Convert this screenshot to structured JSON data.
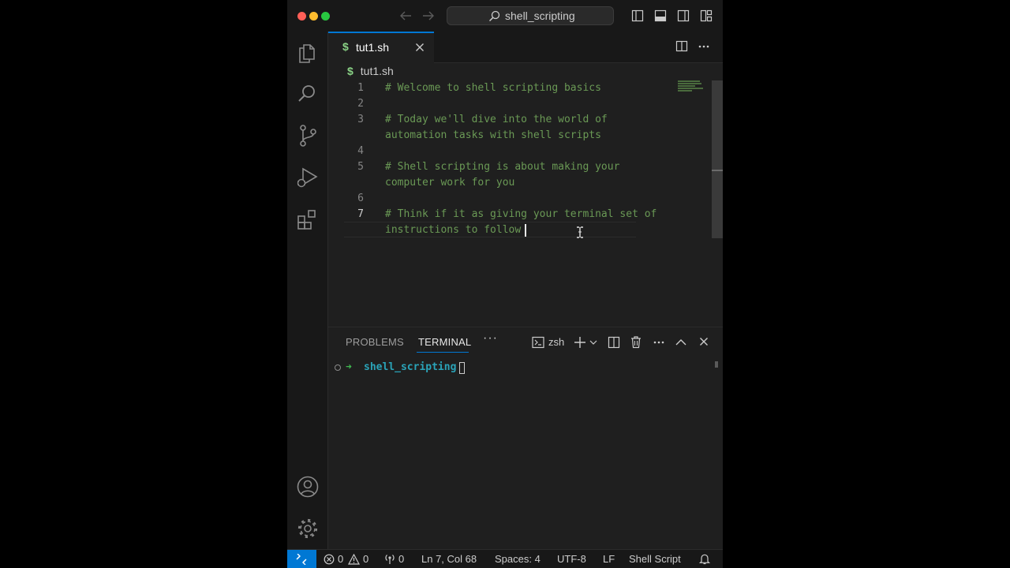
{
  "titlebar": {
    "search_label": "shell_scripting"
  },
  "editor": {
    "tab": {
      "icon": "$",
      "name": "tut1.sh"
    },
    "breadcrumb": {
      "icon": "$",
      "file": "tut1.sh"
    },
    "lines": [
      {
        "num": "1",
        "text": [
          "# Welcome to shell scripting basics"
        ]
      },
      {
        "num": "2",
        "text": [
          ""
        ]
      },
      {
        "num": "3",
        "text": [
          "# Today we'll dive into the world of",
          "automation tasks with shell scripts"
        ]
      },
      {
        "num": "4",
        "text": [
          ""
        ]
      },
      {
        "num": "5",
        "text": [
          "# Shell scripting is about making your",
          "computer work for you"
        ]
      },
      {
        "num": "6",
        "text": [
          ""
        ]
      },
      {
        "num": "7",
        "text": [
          "# Think if it as giving your terminal set of",
          "instructions to follow"
        ]
      }
    ]
  },
  "panel": {
    "tabs": {
      "problems": "PROBLEMS",
      "terminal": "TERMINAL"
    },
    "more": "···",
    "shell": "zsh",
    "terminal": {
      "prompt_arrow": "➜",
      "dir": "shell_scripting"
    }
  },
  "statusbar": {
    "errors": "0",
    "warnings": "0",
    "ports": "0",
    "position": "Ln 7, Col 68",
    "spaces": "Spaces: 4",
    "encoding": "UTF-8",
    "eol": "LF",
    "language": "Shell Script"
  },
  "colors": {
    "accent": "#0078d4",
    "comment": "#6a9955",
    "dollar": "#89d185",
    "terminal_dir": "#2aa3b8",
    "terminal_arrow": "#3fb950",
    "traffic_close": "#ff5f57",
    "traffic_min": "#febc2e",
    "traffic_max": "#28c840"
  },
  "icons": [
    "explorer-icon",
    "search-icon",
    "source-control-icon",
    "run-debug-icon",
    "extensions-icon",
    "account-icon",
    "settings-gear-icon",
    "split-editor-icon",
    "more-actions-icon",
    "close-icon",
    "terminal-icon",
    "plus-icon",
    "chevron-down-icon",
    "trash-icon",
    "chevron-up-icon",
    "bell-icon",
    "remote-icon",
    "error-icon",
    "warning-icon",
    "ports-icon",
    "back-arrow-icon",
    "forward-arrow-icon",
    "toggle-sidebar-icon",
    "toggle-panel-icon",
    "toggle-secondary-sidebar-icon",
    "customize-layout-icon"
  ]
}
